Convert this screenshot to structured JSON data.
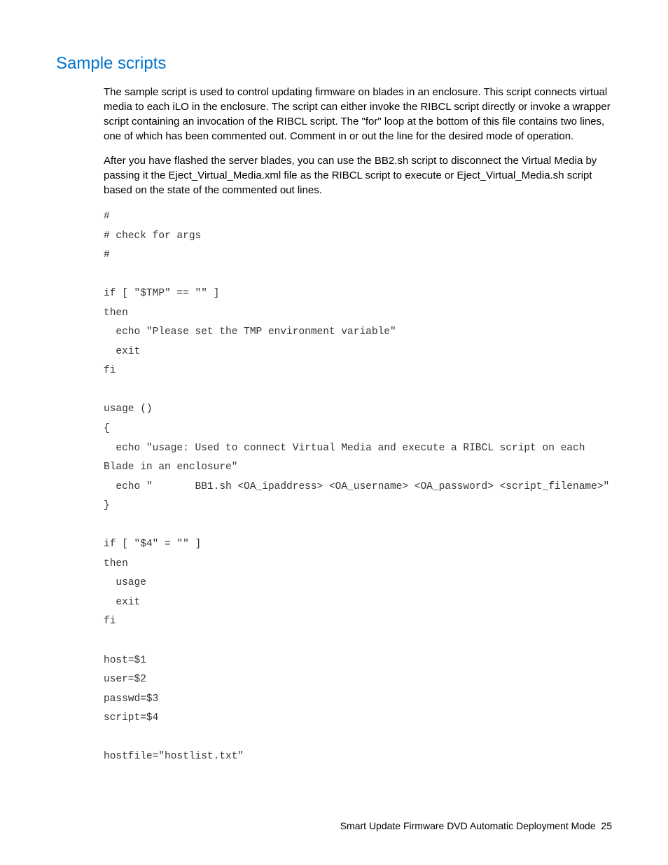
{
  "heading": "Sample scripts",
  "paragraph1": "The sample script is used to control updating firmware on blades in an enclosure. This script connects virtual media to each iLO in the enclosure. The script can either invoke the RIBCL script directly or invoke a wrapper script containing an invocation of the RIBCL script. The \"for\" loop at the bottom of this file contains two lines, one of which has been commented out. Comment in or out the line for the desired mode of operation.",
  "paragraph2": "After you have flashed the server blades, you can use the BB2.sh script to disconnect the Virtual Media by passing it the Eject_Virtual_Media.xml file as the RIBCL script to execute or Eject_Virtual_Media.sh script based on the state of the commented out lines.",
  "code": "#\n# check for args\n#\n\nif [ \"$TMP\" == \"\" ]\nthen\n  echo \"Please set the TMP environment variable\"\n  exit\nfi\n\nusage ()\n{\n  echo \"usage: Used to connect Virtual Media and execute a RIBCL script on each Blade in an enclosure\"\n  echo \"       BB1.sh <OA_ipaddress> <OA_username> <OA_password> <script_filename>\"\n}\n\nif [ \"$4\" = \"\" ]\nthen\n  usage\n  exit\nfi\n\nhost=$1\nuser=$2\npasswd=$3\nscript=$4\n\nhostfile=\"hostlist.txt\"",
  "footer_text": "Smart Update Firmware DVD Automatic Deployment Mode",
  "footer_page": "25"
}
